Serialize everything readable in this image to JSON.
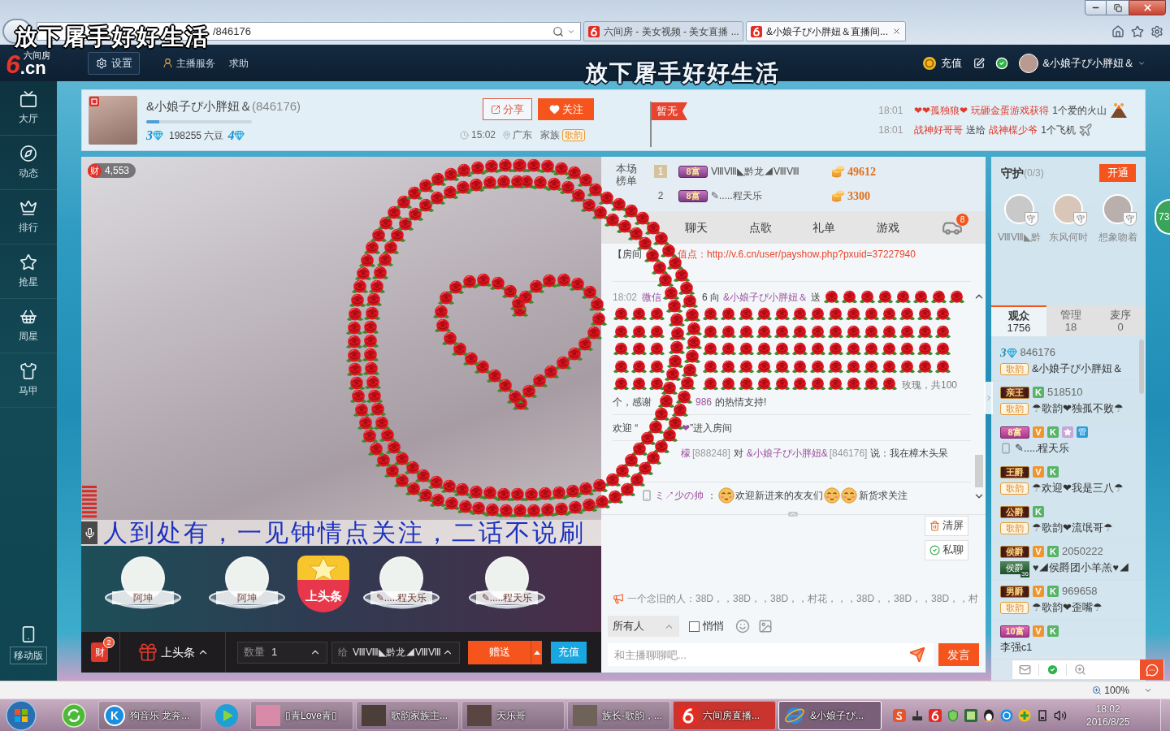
{
  "desktop_lyrics": [
    "放下屠手好好生活",
    "放下屠手好好生活"
  ],
  "browser": {
    "address": "/846176",
    "tabs": [
      {
        "title": "六间房 - 美女视频 - 美女直播 ...",
        "selected": false
      },
      {
        "title": "&小娘子ぴ小胖妞＆直播间...",
        "selected": true
      }
    ]
  },
  "site_header": {
    "logo": {
      "mark": "6",
      "caption": "六间房",
      "domain": ".cn"
    },
    "settings": "设置",
    "links": [
      "主播服务",
      "求助"
    ],
    "recharge": "充值",
    "user": "&小娘子ぴ小胖妞＆"
  },
  "sidebar": {
    "items": [
      "大厅",
      "动态",
      "排行",
      "抢星",
      "周星",
      "马甲"
    ],
    "mobile": "移动版"
  },
  "room": {
    "name": "&小娘子ぴ小胖妞＆",
    "id": "(846176)",
    "level": 0.12,
    "wealth_level": "3",
    "beans": "198255 六豆",
    "star_level": "4",
    "share": "分享",
    "follow": "关注",
    "time": "15:02",
    "location": "广东",
    "family_label": "家族",
    "family_tag": "歌韵",
    "flag": "暂无",
    "notices": [
      {
        "time": "18:01",
        "parts": [
          {
            "text": "❤❤孤独狼❤",
            "kind": "highlight"
          },
          {
            "text": "玩砸金蛋游戏获得",
            "kind": "highlight"
          },
          {
            "text": "1个爱的火山",
            "kind": "plain"
          }
        ]
      },
      {
        "time": "18:01",
        "parts": [
          {
            "text": "战神好哥哥",
            "kind": "highlight"
          },
          {
            "text": "送给",
            "kind": "plain"
          },
          {
            "text": "战神楳少爷",
            "kind": "highlight"
          },
          {
            "text": "1个飞机",
            "kind": "plain"
          }
        ]
      }
    ]
  },
  "video": {
    "wealth_badge": "财",
    "wealth_count": "4,553",
    "marquee": "人到处有，一见钟情点关注，二话不说刷"
  },
  "showcase": [
    {
      "name": "阿坤",
      "kind": "avatar"
    },
    {
      "name": "阿坤",
      "kind": "avatar"
    },
    {
      "name": "上头条",
      "kind": "headline"
    },
    {
      "name": "✎.....程天乐",
      "kind": "avatar"
    },
    {
      "name": "✎.....程天乐",
      "kind": "avatar"
    }
  ],
  "gift_bar": {
    "wealth_badge": "财",
    "wealth_count": "2",
    "gift": "上头条",
    "quantity_label": "数量",
    "quantity": "1",
    "recipient_label": "给",
    "recipient": "ⅧⅧ◣黔龙◢ⅧⅧ",
    "send": "赠送",
    "recharge": "充值"
  },
  "ranking": {
    "label": "本场榜单",
    "rows": [
      {
        "rank": "1",
        "badge": "8富",
        "name": "ⅧⅧ◣黔龙◢ⅧⅧ",
        "score": "49612"
      },
      {
        "rank": "2",
        "badge": "8富",
        "name": "✎.....程天乐",
        "score": "3300"
      }
    ]
  },
  "chat": {
    "tabs": [
      {
        "label": "聊天",
        "selected": false
      },
      {
        "label": "点歌",
        "selected": false
      },
      {
        "label": "礼单",
        "selected": false
      },
      {
        "label": "游戏",
        "selected": false
      }
    ],
    "car_badge": "8",
    "messages": [
      {
        "kind": "notice",
        "parts": [
          {
            "text": "【房间",
            "kind": "plain"
          },
          {
            "text": "值点：http://v.6.cn/user/payshow.php?pxuid=37227940",
            "kind": "link"
          }
        ]
      },
      {
        "kind": "gift",
        "time": "18:02",
        "parts": [
          {
            "text": "微信",
            "kind": "name"
          },
          {
            "text": "6 向",
            "kind": "plain"
          },
          {
            "text": "&小娘子ぴ小胖妞＆",
            "kind": "name"
          },
          {
            "text": "送",
            "kind": "plain"
          }
        ],
        "tail": "玫瑰，共100",
        "thanks": [
          {
            "text": "个，感谢",
            "kind": "plain"
          },
          {
            "text": "986",
            "kind": "name"
          },
          {
            "text": "的热情支持!",
            "kind": "plain"
          }
        ]
      },
      {
        "kind": "enter",
        "parts": [
          {
            "text": "欢迎 “",
            "kind": "plain"
          },
          {
            "text": "❤",
            "kind": "name"
          },
          {
            "text": "”进入房间",
            "kind": "plain"
          }
        ]
      },
      {
        "kind": "speech",
        "parts": [
          {
            "text": "檬",
            "kind": "name"
          },
          {
            "text": "[888248]",
            "kind": "id"
          },
          {
            "text": "对",
            "kind": "plain"
          },
          {
            "text": "&小娘子ぴ小胖妞&",
            "kind": "name"
          },
          {
            "text": "[846176]",
            "kind": "id"
          },
          {
            "text": "说：我在樟木头呆",
            "kind": "plain"
          }
        ]
      },
      {
        "kind": "mobile",
        "parts": [
          {
            "text": "ミ↗少の帅",
            "kind": "name"
          },
          {
            "text": "：",
            "kind": "plain"
          },
          {
            "kind": "emoji"
          },
          {
            "text": "欢迎新进来的友友们",
            "kind": "plain"
          },
          {
            "kind": "emoji"
          },
          {
            "kind": "emoji"
          },
          {
            "text": "新货求关注",
            "kind": "plain"
          }
        ]
      }
    ],
    "actions": [
      "清屏",
      "私聊"
    ],
    "notice": "一个念旧的人：38D，，38D，，38D，，村花，，，38D，，38D，，38D，，村",
    "audience_select": "所有人",
    "whisper": {
      "label": "悄悄",
      "checked": false
    },
    "input": {
      "placeholder": "和主播聊聊吧..."
    },
    "send": "发言"
  },
  "guard": {
    "title": "守护",
    "count": "(0/3)",
    "open": "开通",
    "members": [
      {
        "name": "ⅧⅧ◣黔",
        "badge": "守"
      },
      {
        "name": "东风何时",
        "badge": "守"
      },
      {
        "name": "想象吻着",
        "badge": "守"
      }
    ]
  },
  "audience": {
    "tabs": [
      {
        "label": "观众",
        "count": "1756",
        "selected": true
      },
      {
        "label": "管理",
        "count": "18",
        "selected": false
      },
      {
        "label": "麦序",
        "count": "0",
        "selected": false
      }
    ],
    "users": [
      {
        "badges": [
          {
            "kind": "level",
            "text": "3"
          }
        ],
        "id": "846176",
        "prefix": {
          "kind": "tag",
          "text": "歌韵"
        },
        "name": "&小娘子ぴ小胖妞＆"
      },
      {
        "badges": [
          {
            "kind": "noble",
            "text": "亲王"
          },
          {
            "kind": "k",
            "text": "K"
          }
        ],
        "id": "518510",
        "prefix": {
          "kind": "tag",
          "text": "歌韵"
        },
        "name": "☂歌韵❤独孤不败☂"
      },
      {
        "badges": [
          {
            "kind": "wealth",
            "text": "8富"
          },
          {
            "kind": "vip",
            "text": "V"
          },
          {
            "kind": "k",
            "text": "K"
          },
          {
            "kind": "star"
          },
          {
            "kind": "admin",
            "text": "管"
          }
        ],
        "prefix": {
          "kind": "phone"
        },
        "name": "✎.....程天乐"
      },
      {
        "badges": [
          {
            "kind": "noble",
            "text": "王爵"
          },
          {
            "kind": "vip",
            "text": "V"
          },
          {
            "kind": "k",
            "text": "K"
          }
        ],
        "prefix": {
          "kind": "tag",
          "text": "歌韵"
        },
        "name": "☂欢迎❤我是三八☂"
      },
      {
        "badges": [
          {
            "kind": "noble",
            "text": "公爵"
          },
          {
            "kind": "k",
            "text": "K"
          }
        ],
        "prefix": {
          "kind": "tag",
          "text": "歌韵"
        },
        "name": "☂歌韵❤流氓哥☂"
      },
      {
        "badges": [
          {
            "kind": "noble",
            "text": "侯爵"
          },
          {
            "kind": "vip",
            "text": "V"
          },
          {
            "kind": "k",
            "text": "K"
          }
        ],
        "id": "2050222",
        "prefix": {
          "kind": "title",
          "text": "侯爵",
          "sub": "36"
        },
        "name": "♥◢侯爵团小羊羔♥◢"
      },
      {
        "badges": [
          {
            "kind": "noble",
            "text": "男爵"
          },
          {
            "kind": "vip",
            "text": "V"
          },
          {
            "kind": "k",
            "text": "K"
          }
        ],
        "id": "969658",
        "prefix": {
          "kind": "tag",
          "text": "歌韵"
        },
        "name": "☂歌韵❤歪嘴☂"
      },
      {
        "badges": [
          {
            "kind": "wealth",
            "text": "10富"
          },
          {
            "kind": "vip",
            "text": "V"
          },
          {
            "kind": "k",
            "text": "K"
          }
        ],
        "name": "李强c1"
      }
    ]
  },
  "online_badge": "73",
  "status_bar": {
    "zoom": "100%"
  },
  "taskbar": {
    "windows": [
      {
        "label": "狗音乐 龙奔...",
        "kind": "app",
        "letter": "K",
        "selected": false,
        "flashing": false
      },
      {
        "label": "▯青Love青▯",
        "kind": "photo",
        "selected": false,
        "flashing": false
      },
      {
        "label": "歌韵家族主...",
        "kind": "photo",
        "selected": false,
        "flashing": false
      },
      {
        "label": "天乐哥",
        "kind": "photo",
        "selected": false,
        "flashing": false
      },
      {
        "label": "族长-歌韵，...",
        "kind": "photo",
        "selected": false,
        "flashing": false
      },
      {
        "label": "六间房直播...",
        "kind": "logo",
        "selected": false,
        "flashing": true
      },
      {
        "label": "&小娘子ぴ...",
        "kind": "browser",
        "selected": true,
        "flashing": false
      }
    ],
    "time": "18:02",
    "date": "2016/8/25"
  }
}
